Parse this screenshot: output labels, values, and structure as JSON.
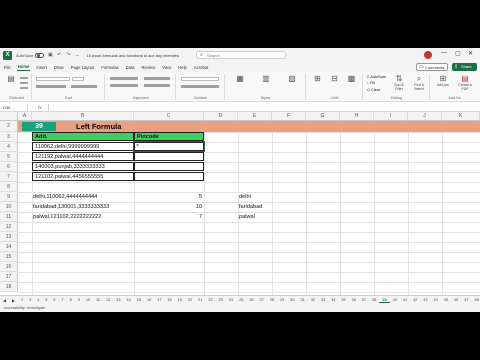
{
  "titlebar": {
    "autosave_label": "AutoSave",
    "doc_title": "15 excel formulas and functions to ace any interview",
    "search_placeholder": "Search",
    "app_letter": "X"
  },
  "menu": [
    "File",
    "Home",
    "Insert",
    "Draw",
    "Page Layout",
    "Formulas",
    "Data",
    "Review",
    "View",
    "Help",
    "Acrobat"
  ],
  "menu_active": "Home",
  "actions": {
    "comments": "Comments",
    "share": "Share"
  },
  "ribbon_groups": [
    "Clipboard",
    "Font",
    "Alignment",
    "Number",
    "Styles",
    "Cells",
    "Editing",
    "Add-ins"
  ],
  "ribbon_buttons": {
    "autosum": "AutoSum",
    "fill": "Fill",
    "clear": "Clear",
    "sort_filter": "Sort & Filter",
    "find_select": "Find & Select",
    "addins": "Add-ins",
    "create_pdf": "Create a PDF"
  },
  "formula_bar": {
    "name_box": "D35",
    "fx": "fx",
    "content": ""
  },
  "columns": [
    "A",
    "B",
    "C",
    "D",
    "E",
    "F",
    "G",
    "H",
    "I",
    "J",
    "K"
  ],
  "rows": [
    "2",
    "3",
    "4",
    "5",
    "6",
    "7",
    "8",
    "9",
    "10",
    "11",
    "12",
    "13",
    "14",
    "15",
    "16",
    "17",
    "18"
  ],
  "banner": {
    "number": "39",
    "title": "Left Formula",
    "color": "#e8a080",
    "number_color": "#1aa37a"
  },
  "table": {
    "headers": [
      "Add.",
      "Pincode"
    ],
    "header_color": "#3fd05a",
    "rows": [
      [
        "110062,delhi,9999999999",
        ""
      ],
      [
        "121192,palwal,4444444444",
        ""
      ],
      [
        "140003,punjab,3333333333",
        ""
      ],
      [
        "121102,palwal,4456555555",
        ""
      ]
    ]
  },
  "lower": [
    {
      "b": "delhi,110062,4444444444",
      "c": "5",
      "e": "delhi"
    },
    {
      "b": "faridabad,130001,3333333333",
      "c": "10",
      "e": "faridabad"
    },
    {
      "b": "palwal,121102,2222222222",
      "c": "7",
      "e": "palwal"
    }
  ],
  "sheet_tabs": [
    "2",
    "3",
    "4",
    "5",
    "6",
    "7",
    "8",
    "9",
    "10",
    "11",
    "12",
    "13",
    "14",
    "15",
    "16",
    "17",
    "18",
    "19",
    "20",
    "21",
    "22",
    "23",
    "24",
    "25",
    "26",
    "27",
    "28",
    "29",
    "30",
    "31",
    "32",
    "33",
    "34",
    "35",
    "36",
    "37",
    "38",
    "39",
    "40",
    "41",
    "42",
    "43",
    "44",
    "45",
    "46",
    "47",
    "48",
    "49",
    "50",
    "51",
    "52",
    "53"
  ],
  "sheet_active": "39",
  "status": "Accessibility: Investigate"
}
